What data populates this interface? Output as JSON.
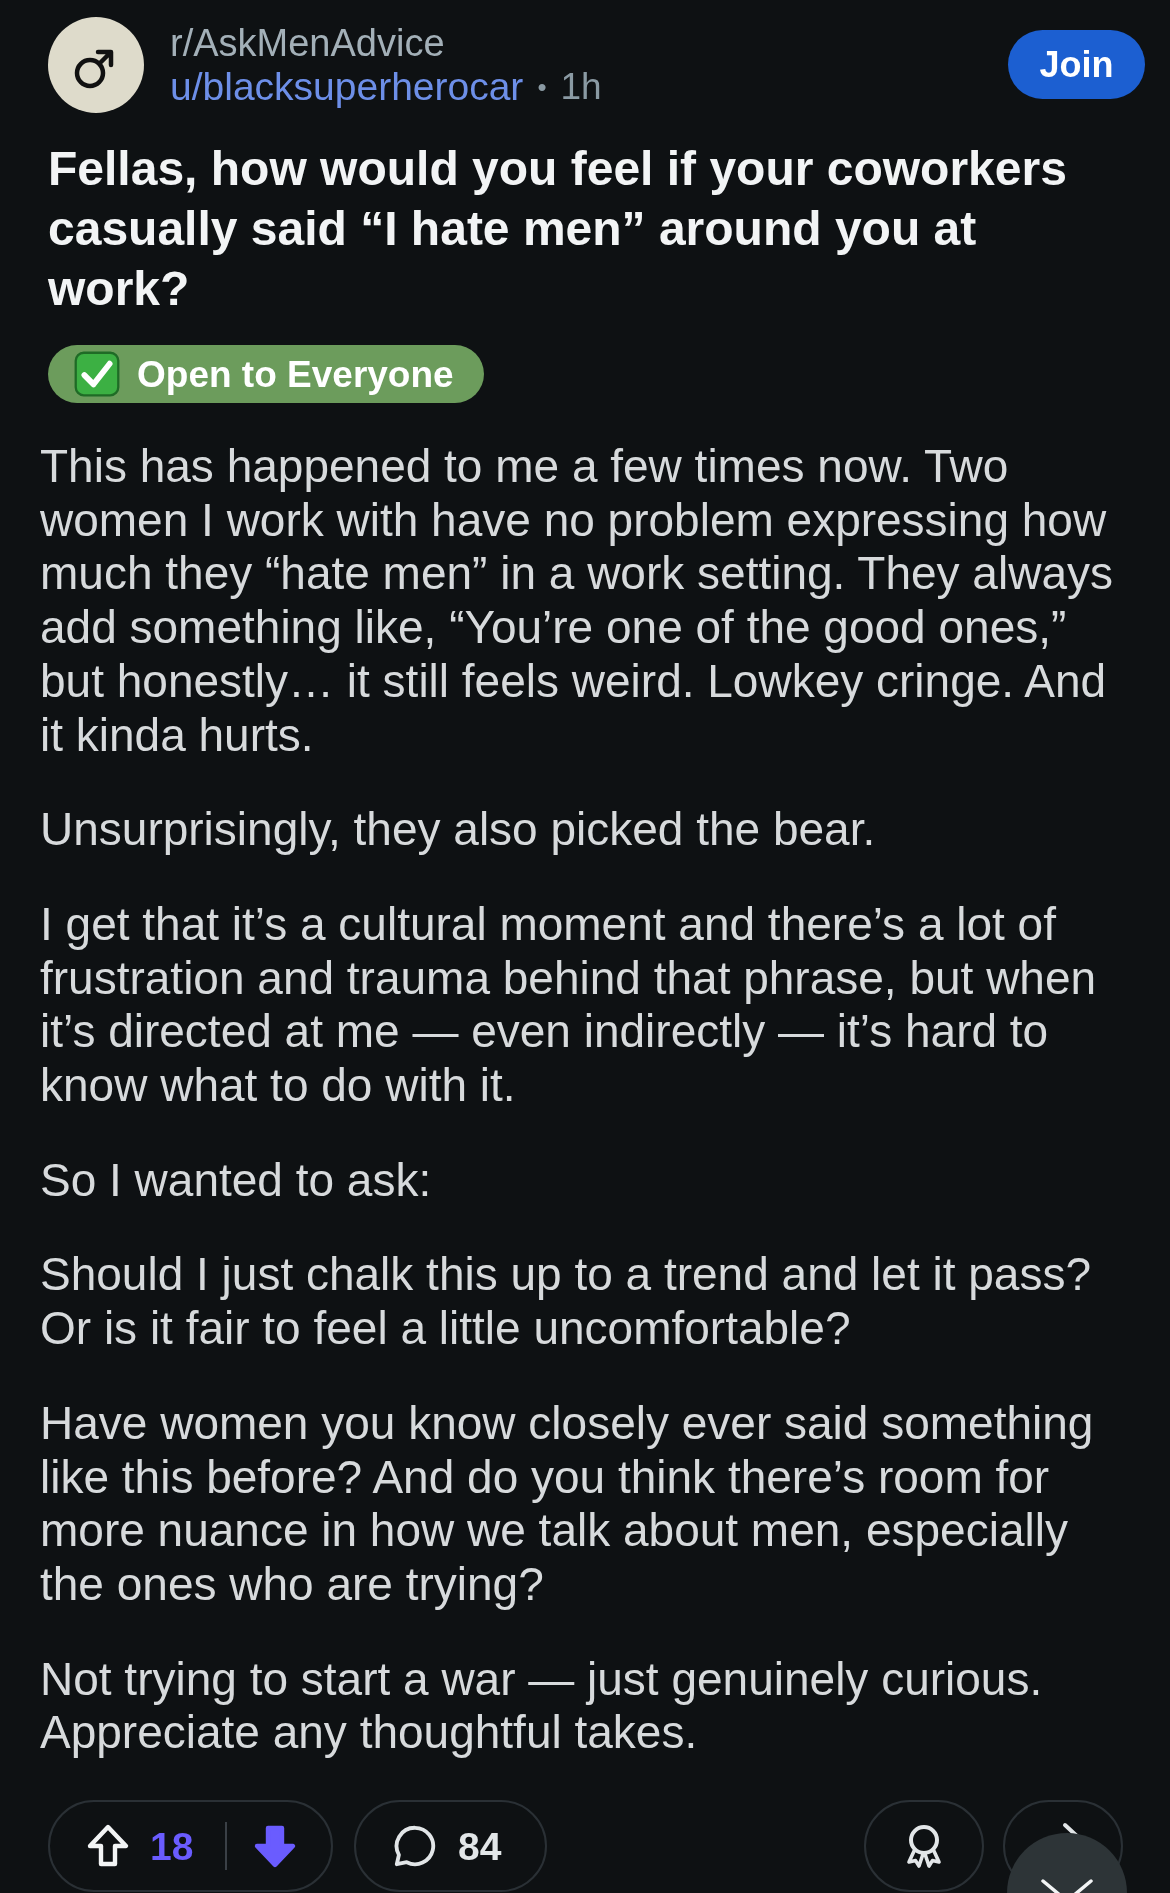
{
  "header": {
    "community": "r/AskMenAdvice",
    "author": "u/blacksuperherocar",
    "separator": "•",
    "age": "1h",
    "join_button": "Join"
  },
  "post": {
    "title": "Fellas, how would you feel if your coworkers casually said “I hate men” around you at work?",
    "flair": "Open to Everyone",
    "body": [
      "This has happened to me a few times now. Two women I work with have no problem expressing how much they “hate men” in a work setting. They always add something like, “You’re one of the good ones,” but honestly… it still feels weird. Lowkey cringe. And it kinda hurts.",
      "Unsurprisingly, they also picked the bear.",
      "I get that it’s a cultural moment and there’s a lot of frustration and trauma behind that phrase, but when it’s directed at me — even indirectly — it’s hard to know what to do with it.",
      "So I wanted to ask:",
      "Should I just chalk this up to a trend and let it pass? Or is it fair to feel a little uncomfortable?",
      "Have women you know closely ever said something like this before? And do you think there’s room for more nuance in how we talk about men, especially the ones who are trying?",
      "Not trying to start a war — just genuinely curious. Appreciate any thoughtful takes."
    ]
  },
  "actions": {
    "upvoted": false,
    "downvoted": true,
    "score": "18",
    "comments": "84"
  }
}
